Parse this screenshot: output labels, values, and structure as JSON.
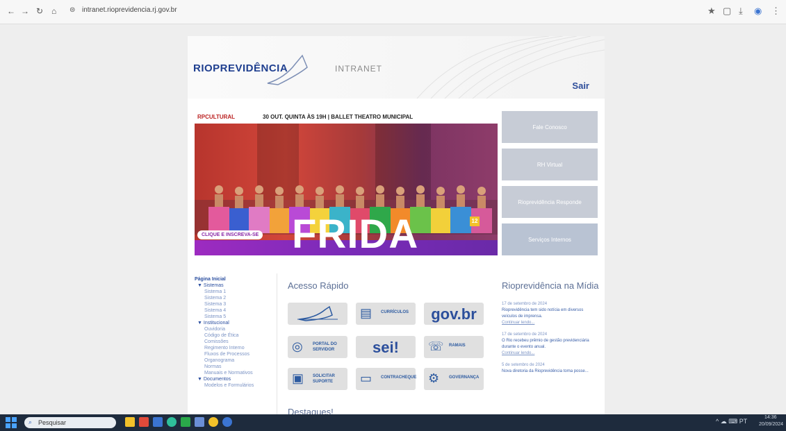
{
  "browser": {
    "url": "intranet.rioprevidencia.rj.gov.br",
    "back_icon": "←",
    "forward_icon": "→",
    "reload_icon": "↻",
    "home_icon": "⌂",
    "right_icons": [
      "★",
      "▢",
      "⤓",
      "◉",
      "⋮"
    ]
  },
  "header": {
    "logo": "RIOPREVIDÊNCIA",
    "section": "INTRANET",
    "logout": "Sair"
  },
  "banner": {
    "brand": "RPCULTURAL",
    "headline": "30 OUT. QUINTA ÀS 19H | BALLET THEATRO MUNICIPAL",
    "title": "FRIDA",
    "badge": "CLIQUE E INSCREVA-SE",
    "age_rating": "12"
  },
  "side_buttons": [
    "Fale Conosco",
    "RH Virtual",
    "Rioprevidência Responde",
    "Serviços Internos"
  ],
  "sidebar": {
    "home": "Página Inicial",
    "groups": [
      {
        "title": "▼ Sistemas",
        "items": [
          "Sistema 1",
          "Sistema 2",
          "Sistema 3",
          "Sistema 4",
          "Sistema 5"
        ]
      },
      {
        "title": "▼ Institucional",
        "items": [
          "Ouvidoria",
          "Código de Ética",
          "Comissões",
          "Regimento Interno",
          "Fluxos de Processos",
          "Organograma",
          "Normas",
          "Manuais e Normativos"
        ]
      },
      {
        "title": "▼ Documentos",
        "items": [
          "Modelos e Formulários"
        ]
      }
    ]
  },
  "quick_access": {
    "title": "Acesso Rápido",
    "buttons": [
      {
        "label": "",
        "icon": "swoosh",
        "big": ""
      },
      {
        "label": "CURRÍCULOS",
        "icon": "▤",
        "big": ""
      },
      {
        "label": "",
        "icon": "",
        "big": "gov.br"
      },
      {
        "label": "PORTAL DO SERVIDOR",
        "icon": "◎",
        "big": ""
      },
      {
        "label": "",
        "icon": "",
        "big": "sei!"
      },
      {
        "label": "RAMAIS",
        "icon": "☏",
        "big": ""
      },
      {
        "label": "SOLICITAR SUPORTE",
        "icon": "▣",
        "big": ""
      },
      {
        "label": "CONTRACHEQUE",
        "icon": "▭",
        "big": ""
      },
      {
        "label": "GOVERNANÇA",
        "icon": "⚙",
        "big": ""
      }
    ]
  },
  "media": {
    "title": "Rioprevidência na Mídia",
    "items": [
      {
        "date": "17 de setembro de 2024",
        "text": "Rioprevidência tem sido notícia em diversos veículos de imprensa.",
        "more": "Continuar lendo..."
      },
      {
        "date": "17 de setembro de 2024",
        "text": "O Rio recebeu prêmio de gestão previdenciária durante o evento anual.",
        "more": "Continuar lendo..."
      },
      {
        "date": "5 de setembro de 2024",
        "text": "Nova diretoria da Rioprevidência toma posse...",
        "more": ""
      }
    ]
  },
  "highlights": {
    "title": "Destaques!"
  },
  "taskbar": {
    "search_placeholder": "Pesquisar",
    "tray_text": "^  ☁  ⌨  PT",
    "time": "14:36",
    "date": "20/09/2024"
  },
  "colors": {
    "brand_blue": "#1f3f8f",
    "side_button": "#c7ccd6",
    "banner_purple": "#8a2aa8",
    "taskbar": "#1e2b3d"
  }
}
